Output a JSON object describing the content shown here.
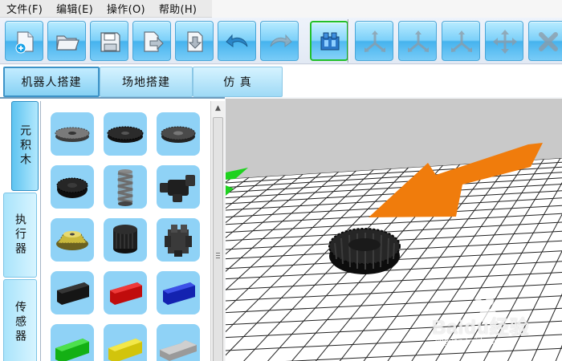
{
  "menu": {
    "items": [
      "文件(F)",
      "编辑(E)",
      "操作(O)",
      "帮助(H)"
    ]
  },
  "toolbar": {
    "buttons": [
      {
        "name": "new-file",
        "state": "normal"
      },
      {
        "name": "open-folder",
        "state": "normal"
      },
      {
        "name": "save",
        "state": "normal"
      },
      {
        "name": "export",
        "state": "normal"
      },
      {
        "name": "import",
        "state": "normal"
      },
      {
        "name": "undo",
        "state": "normal"
      },
      {
        "name": "redo",
        "state": "disabled"
      },
      {
        "name": "blocks-mode",
        "state": "active"
      },
      {
        "name": "align-a",
        "state": "disabled"
      },
      {
        "name": "align-b",
        "state": "disabled"
      },
      {
        "name": "align-c",
        "state": "disabled"
      },
      {
        "name": "move",
        "state": "disabled"
      },
      {
        "name": "delete",
        "state": "disabled"
      }
    ]
  },
  "tabs": [
    {
      "label": "机器人搭建",
      "active": true
    },
    {
      "label": "场地搭建",
      "active": false
    },
    {
      "label": "仿  真",
      "active": false
    }
  ],
  "side_tabs": [
    {
      "label": "元积木",
      "active": true
    },
    {
      "label": "执行器",
      "active": false
    },
    {
      "label": "传感器",
      "active": false
    }
  ],
  "parts": [
    {
      "icon": "small-gear-icon",
      "color": "#555555"
    },
    {
      "icon": "black-gear-icon",
      "color": "#1e1e1e"
    },
    {
      "icon": "dark-gear-icon",
      "color": "#3a3a3a"
    },
    {
      "icon": "tire-icon",
      "color": "#1a1a1a"
    },
    {
      "icon": "worm-gear-icon",
      "color": "#6a6a6a"
    },
    {
      "icon": "connector-icon",
      "color": "#2a2a2a"
    },
    {
      "icon": "bevel-gear-icon",
      "color": "#d8c84a"
    },
    {
      "icon": "gear-drum-icon",
      "color": "#1e1e1e"
    },
    {
      "icon": "crown-gear-icon",
      "color": "#3c3c3c"
    },
    {
      "icon": "black-beam-icon",
      "color": "#151515"
    },
    {
      "icon": "red-beam-icon",
      "color": "#d01010"
    },
    {
      "icon": "blue-beam-icon",
      "color": "#1428c0"
    },
    {
      "icon": "green-beam-icon",
      "color": "#18c018"
    },
    {
      "icon": "yellow-beam-icon",
      "color": "#e0d010"
    },
    {
      "icon": "gray-beam-icon",
      "color": "#b4b4b4"
    }
  ],
  "colors": {
    "accent_blue": "#7cd0f9",
    "active_green": "#22c02a",
    "arrow_orange": "#f08010",
    "viewport_bg": "#c9c9c9"
  },
  "watermark": {
    "brand": "Baidu经验",
    "site": "jingyan.baidu.com"
  }
}
